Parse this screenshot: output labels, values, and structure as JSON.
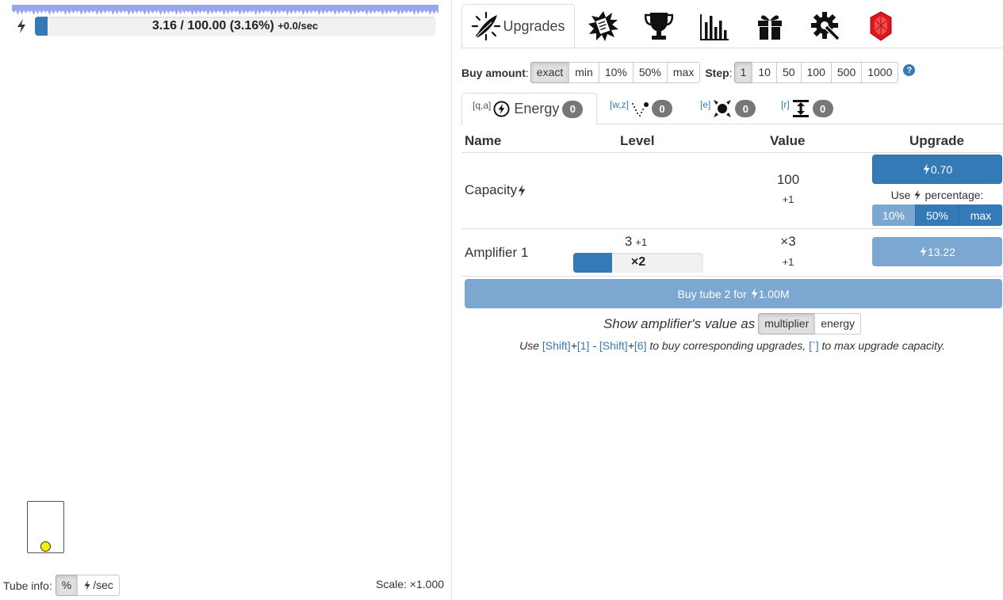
{
  "left": {
    "energy": {
      "text": "3.16 / 100.00 (3.16%)",
      "rate": "+0.0/sec",
      "fill_fraction": 0.0316
    },
    "tube_info_label": "Tube info:",
    "tube_info_options": [
      "%",
      "/sec"
    ],
    "scale_label": "Scale: ×1.000"
  },
  "top_tabs": {
    "upgrades_label": "Upgrades",
    "icons": [
      "feather-icon",
      "scroll-icon",
      "trophy-icon",
      "stats-icon",
      "gift-icon",
      "settings-icon",
      "ruby-icon"
    ]
  },
  "buy_row": {
    "buy_amount_label": "Buy amount",
    "buy_amount_options": [
      "exact",
      "min",
      "10%",
      "50%",
      "max"
    ],
    "step_label": "Step",
    "step_options": [
      "1",
      "10",
      "50",
      "100",
      "500",
      "1000"
    ],
    "colon": ":",
    "help": "?"
  },
  "sub_tabs": {
    "energy": {
      "hotkey": "[q,a]",
      "label": "Energy",
      "count": "0"
    },
    "tab2": {
      "hotkey": "[w,z]",
      "count": "0"
    },
    "tab3": {
      "hotkey": "[e]",
      "count": "0"
    },
    "tab4": {
      "hotkey": "[r]",
      "count": "0"
    }
  },
  "table": {
    "headers": {
      "name": "Name",
      "level": "Level",
      "value": "Value",
      "upgrade": "Upgrade"
    },
    "capacity": {
      "name": "Capacity",
      "value": "100",
      "value_inc": "+1",
      "cost": "0.70",
      "use_label_prefix": "Use",
      "use_label_suffix": "percentage:",
      "pct_options": [
        "10%",
        "50%",
        "max"
      ]
    },
    "amplifier": {
      "name": "Amplifier 1",
      "level": "3",
      "level_inc": "+1",
      "bar_text": "×2",
      "bar_fill_fraction": 0.3,
      "value": "×3",
      "value_inc": "+1",
      "cost": "13.22"
    }
  },
  "buy_tube": {
    "prefix": "Buy tube 2 for",
    "cost": "1.00M"
  },
  "show_amp": {
    "label": "Show amplifier's value as",
    "options": [
      "multiplier",
      "energy"
    ]
  },
  "hint": {
    "use": "Use",
    "k1": "[Shift]",
    "plus": "+",
    "k2": "[1]",
    "dash": "-",
    "k3": "[Shift]",
    "k4": "[6]",
    "mid": "to buy corresponding upgrades,",
    "k5": "[`]",
    "end": "to max upgrade capacity."
  },
  "colors": {
    "accent": "#337ab7",
    "accent_disabled": "#7ba7d0",
    "badge": "#777777",
    "ball": "#f2ef00"
  }
}
